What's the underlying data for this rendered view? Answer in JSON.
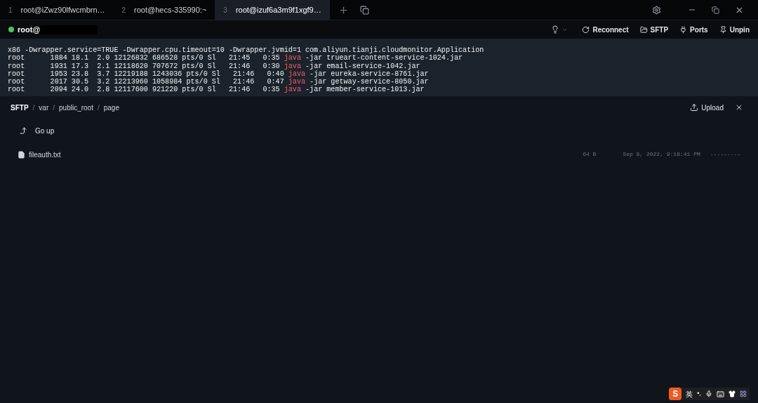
{
  "tabs": [
    {
      "number": "1",
      "title": "root@iZwz90lfwcmbrn…",
      "selected": false
    },
    {
      "number": "2",
      "title": "root@hecs-335990:~",
      "selected": false
    },
    {
      "number": "3",
      "title": "root@izuf6a3m9f1xgf9…",
      "selected": true
    }
  ],
  "session": {
    "user": "root@",
    "connected": true
  },
  "toolbar": [
    "Reconnect",
    "SFTP",
    "Ports",
    "Unpin"
  ],
  "terminal": {
    "header": "x86 -Dwrapper.service=TRUE -Dwrapper.cpu.timeout=10 -Dwrapper.jvmid=1 com.aliyun.tianji.cloudmonitor.Application",
    "rows": [
      {
        "before": "root      1884 18.1  2.0 12126832 686528 pts/0 Sl   21:45   0:35 ",
        "command": "java",
        "after": " -jar trueart-content-service-1024.jar"
      },
      {
        "before": "root      1931 17.3  2.1 12118620 707672 pts/0 Sl   21:46   0:30 ",
        "command": "java",
        "after": " -jar email-service-1042.jar"
      },
      {
        "before": "root      1953 23.8  3.7 12219188 1243036 pts/0 Sl   21:46   0:40 ",
        "command": "java",
        "after": " -jar eureka-service-8761.jar"
      },
      {
        "before": "root      2017 30.5  3.2 12213960 1058984 pts/0 Sl   21:46   0:47 ",
        "command": "java",
        "after": " -jar getway-service-8050.jar"
      },
      {
        "before": "root      2094 24.0  2.8 12117600 921220 pts/0 Sl   21:46   0:35 ",
        "command": "java",
        "after": " -jar member-service-1013.jar"
      }
    ]
  },
  "sftp": {
    "breadcrumb": [
      "SFTP",
      "var",
      "public_root",
      "page"
    ],
    "separator": "/",
    "upload": "Upload",
    "entries": [
      {
        "kind": "up",
        "name": "Go up"
      },
      {
        "kind": "file",
        "name": "fileauth.txt",
        "size": "64 B",
        "modified": "Sep 8, 2022, 9:18:41 PM",
        "permissions": "---------"
      }
    ]
  },
  "ime": {
    "logo": "S",
    "mode": "英",
    "punct": "•,"
  }
}
